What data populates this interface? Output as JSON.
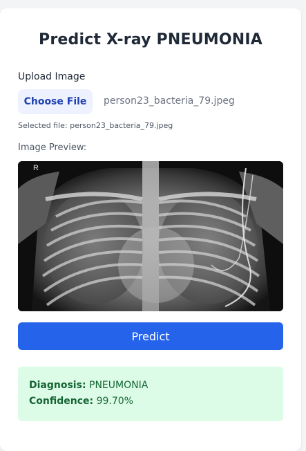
{
  "page": {
    "title": "Predict X-ray PNEUMONIA"
  },
  "upload": {
    "label": "Upload Image",
    "choose_button": "Choose File",
    "file_name": "person23_bacteria_79.jpeg",
    "selected_text": "Selected file: person23_bacteria_79.jpeg"
  },
  "preview": {
    "label": "Image Preview:",
    "marker": "R"
  },
  "actions": {
    "predict_label": "Predict"
  },
  "result": {
    "diagnosis_label": "Diagnosis:",
    "diagnosis_value": "PNEUMONIA",
    "confidence_label": "Confidence:",
    "confidence_value": "99.70%"
  },
  "colors": {
    "accent": "#2563eb",
    "choose_bg": "#eef2ff",
    "choose_text": "#1e40af",
    "result_bg": "#dcfce7",
    "result_text": "#166534"
  }
}
